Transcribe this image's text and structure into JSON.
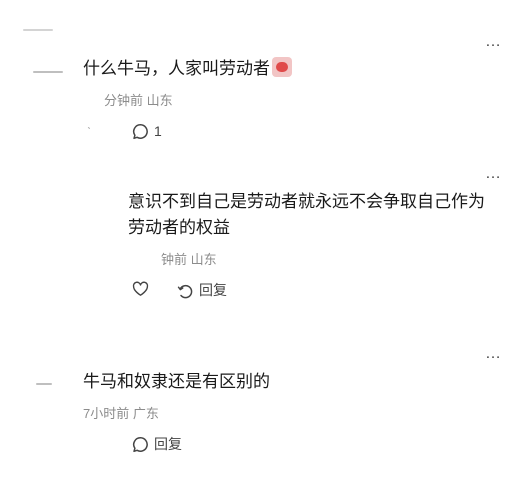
{
  "comments": [
    {
      "text": "什么牛马，人家叫劳动者",
      "meta": "分钟前 山东",
      "reply_count": "1",
      "more": "…"
    },
    {
      "text_line1": "意识不到自己是劳动者就永远不会争取自己作为",
      "text_line2": "劳动者的权益",
      "meta": "钟前 山东",
      "reply_label": "回复",
      "more": "…"
    },
    {
      "text": "牛马和奴隶还是有区别的",
      "meta": "7小时前 广东",
      "reply_label": "回复",
      "more": "…"
    }
  ],
  "icons": {
    "more": "more-dots-icon",
    "comment": "comment-bubble-icon",
    "like": "heart-icon",
    "reply": "reply-arrow-icon",
    "emoji": "laughing-emoji-icon"
  }
}
